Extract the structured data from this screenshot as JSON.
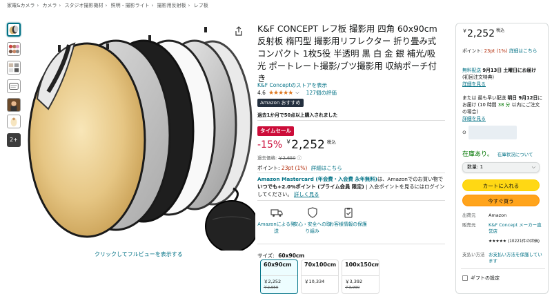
{
  "breadcrumb": [
    "家電&カメラ",
    "カメラ",
    "スタジオ撮影機材",
    "照明・撮影ライト",
    "撮影用反射板",
    "レフ板"
  ],
  "gallery": {
    "more_label": "2+",
    "caption": "クリックしてフルビューを表示する"
  },
  "product": {
    "title": "K&F CONCEPT レフ板 撮影用 四角 60x90cm 反射板 楕円型 撮影用リフレクター 折り畳み式 コンパクト 1枚5役 半透明 黒 白 金 銀 補光/吸光 ポートレート撮影/ブツ撮影用 収納ポーチ付き",
    "store_link": "K&F Conceptのストアを表示",
    "rating": "4.6",
    "stars": "★★★★★",
    "rating_chevron": "⌵",
    "review_count": "127個の評価",
    "choice_badge": "Amazon おすすめ",
    "bought_text": "過去1か月で50点以上購入されました",
    "deal_badge": "タイムセール",
    "discount": "-15%",
    "price_symbol": "￥",
    "price": "2,252",
    "tax_label": "税込",
    "ref_price_label": "過去価格:",
    "ref_price": "￥2,650",
    "info_icon": "ⓘ",
    "points_label": "ポイント:",
    "points_value": "23pt (1%)",
    "points_link": "詳細はこちら",
    "mastercard_bold": "Amazon Mastercard (年会費・入会費 永年無料)",
    "mastercard_mid": "は、Amazonでのお買い物で",
    "mastercard_bold2": "いつでも+2.0%ポイント (プライム会員 限定)",
    "mastercard_tail": "| 入会ポイントを見るにはログインしてください。",
    "mastercard_link": "詳しく見る"
  },
  "features": [
    {
      "icon": "delivery-truck-icon",
      "label": "Amazonによる発送"
    },
    {
      "icon": "shield-icon",
      "label": "安心・安全への取り組み"
    },
    {
      "icon": "clipboard-icon",
      "label": "お客様情報の保護"
    }
  ],
  "sizes": {
    "label": "サイズ:",
    "selected": "60x90cm",
    "options": [
      {
        "name": "60x90cm",
        "price": "￥2,252",
        "was": "￥2,650"
      },
      {
        "name": "70x100cm",
        "price": "￥10,334",
        "was": ""
      },
      {
        "name": "100x150cm",
        "price": "￥3,392",
        "was": "￥3,990"
      }
    ]
  },
  "buybox": {
    "price_symbol": "￥",
    "price": "2,252",
    "tax_label": "税込",
    "points_label": "ポイント:",
    "points_value": "23pt (1%)",
    "points_link": "詳細はこちら",
    "free_ship_label": "無料配送",
    "free_ship_date": "9月13日 土曜日にお届け",
    "free_ship_note": "(初回注文特典)",
    "free_ship_link": "詳細を見る",
    "fast_prefix": "または 最も早い配送",
    "fast_date": "明日 9月12日",
    "fast_mid": "にお届け (10 時間",
    "fast_time": "38 分",
    "fast_tail": "以内にご注文の場合)",
    "fast_link": "詳細を見る",
    "location_icon": "⊙",
    "stock": "在庫あり。",
    "stock_note": "在庫状況について",
    "qty_label": "数量: 1",
    "qty_chevron": "⌵",
    "add_to_cart": "カートに入れる",
    "buy_now": "今すぐ買う",
    "info": [
      {
        "k": "出荷元",
        "v": "Amazon"
      },
      {
        "k": "販売元",
        "v": "K&F Concept メーカー直営店"
      },
      {
        "k": "",
        "v": "★★★★★ (10221件の評価)"
      },
      {
        "k": "支払い方法",
        "v": "お支払い方法を保護しています"
      }
    ],
    "gift_label": "ギフトの設定"
  }
}
